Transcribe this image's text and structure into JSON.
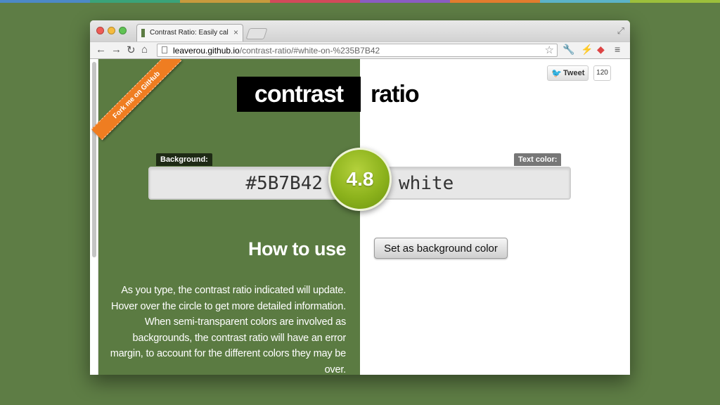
{
  "stripe_colors": [
    "#4c89c7",
    "#3aa37a",
    "#c79a3d",
    "#d2495a",
    "#8a5cc2",
    "#e27c2e",
    "#5bb3c9",
    "#9cbf3b"
  ],
  "browser": {
    "tab_title": "Contrast Ratio: Easily calculate",
    "tab_close": "×",
    "url_host": "leaverou.github.io",
    "url_path": "/contrast-ratio/#white-on-%235B7B42"
  },
  "ribbon": {
    "label": "Fork me on GitHub"
  },
  "logo": {
    "left": "contrast",
    "right": "ratio"
  },
  "tweet": {
    "label": "Tweet",
    "count": "120"
  },
  "tags": {
    "background": "Background:",
    "text_color": "Text color:"
  },
  "inputs": {
    "background_value": "#5B7B42",
    "text_value": "white"
  },
  "ratio": {
    "value": "4.8"
  },
  "buttons": {
    "set_background": "Set as background color"
  },
  "howto": {
    "title": "How to use",
    "text": "As you type, the contrast ratio indicated will update. Hover over the circle to get more detailed information. When semi-transparent colors are involved as backgrounds, the contrast ratio will have an error margin, to account for the different colors they may be over."
  },
  "colors": {
    "background": "#5B7B42",
    "ribbon": "#ef7d21",
    "ratio_badge": "#8cb21c",
    "page_bg": "#5e7d45"
  }
}
